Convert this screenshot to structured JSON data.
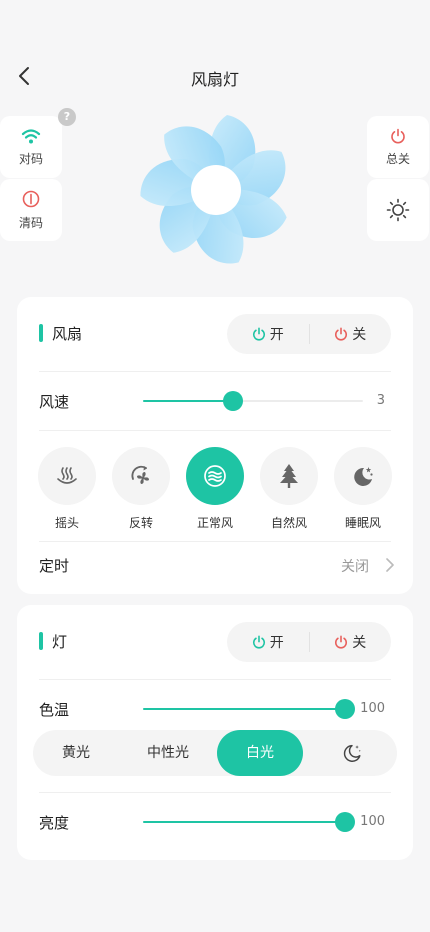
{
  "header": {
    "title": "风扇灯"
  },
  "quick_actions": {
    "pair_label": "对码",
    "clear_label": "清码",
    "help_mark": "?",
    "all_off_label": "总关"
  },
  "fan": {
    "section_title": "风扇",
    "on_label": "开",
    "off_label": "关",
    "speed_label": "风速",
    "speed_value": "3",
    "speed_fraction": 0.41,
    "modes": [
      {
        "label": "摇头",
        "icon": "oscillate-icon",
        "active": false
      },
      {
        "label": "反转",
        "icon": "reverse-icon",
        "active": false
      },
      {
        "label": "正常风",
        "icon": "normal-wind-icon",
        "active": true
      },
      {
        "label": "自然风",
        "icon": "tree-icon",
        "active": false
      },
      {
        "label": "睡眠风",
        "icon": "moon-icon",
        "active": false
      }
    ],
    "timer_label": "定时",
    "timer_value": "关闭"
  },
  "light": {
    "section_title": "灯",
    "on_label": "开",
    "off_label": "关",
    "color_temp_label": "色温",
    "color_temp_value": "100",
    "color_temp_fraction": 1.0,
    "modes": [
      {
        "label": "黄光",
        "active": false
      },
      {
        "label": "中性光",
        "active": false
      },
      {
        "label": "白光",
        "active": true
      },
      {
        "label": "",
        "icon": "night-moon-icon",
        "active": false
      }
    ],
    "brightness_label": "亮度",
    "brightness_value": "100",
    "brightness_fraction": 1.0
  },
  "colors": {
    "accent": "#1ec4a4",
    "power_on": "#1ec4a4",
    "power_off": "#e8605c",
    "fan_blade": "#a9dcf7"
  }
}
